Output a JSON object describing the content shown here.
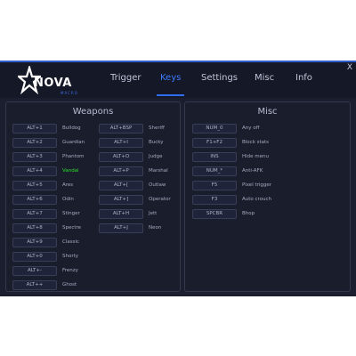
{
  "window": {
    "close_label": "X"
  },
  "logo": {
    "brand": "NOVA",
    "sub": "MACRO"
  },
  "tabs": [
    {
      "label": "Trigger"
    },
    {
      "label": "Keys"
    },
    {
      "label": "Settings"
    },
    {
      "label": "Misc"
    },
    {
      "label": "Info"
    }
  ],
  "active_tab": "Keys",
  "colors": {
    "accent": "#2f6cf0",
    "highlight": "#29e02b",
    "background": "#1b1e2e"
  },
  "weapons": {
    "title": "Weapons",
    "col1": [
      {
        "key": "ALT+1",
        "label": "Bulldog"
      },
      {
        "key": "ALT+2",
        "label": "Guardian"
      },
      {
        "key": "ALT+3",
        "label": "Phantom"
      },
      {
        "key": "ALT+4",
        "label": "Vandal"
      },
      {
        "key": "ALT+5",
        "label": "Ares"
      },
      {
        "key": "ALT+6",
        "label": "Odin"
      },
      {
        "key": "ALT+7",
        "label": "Stinger"
      },
      {
        "key": "ALT+8",
        "label": "Spectre"
      },
      {
        "key": "ALT+9",
        "label": "Classic"
      },
      {
        "key": "ALT+0",
        "label": "Shorty"
      },
      {
        "key": "ALT+-",
        "label": "Frenzy"
      },
      {
        "key": "ALT++",
        "label": "Ghost"
      }
    ],
    "col2": [
      {
        "key": "ALT+BSP",
        "label": "Sheriff"
      },
      {
        "key": "ALT+I",
        "label": "Bucky"
      },
      {
        "key": "ALT+O",
        "label": "Judge"
      },
      {
        "key": "ALT+P",
        "label": "Marshal"
      },
      {
        "key": "ALT+[",
        "label": "Outlaw"
      },
      {
        "key": "ALT+]",
        "label": "Operator"
      },
      {
        "key": "ALT+H",
        "label": "Jett"
      },
      {
        "key": "ALT+J",
        "label": "Neon"
      }
    ]
  },
  "misc": {
    "title": "Misc",
    "items": [
      {
        "key": "NUM_0",
        "label": "Any off"
      },
      {
        "key": "F1+F2",
        "label": "Block stats"
      },
      {
        "key": "INS",
        "label": "Hide menu"
      },
      {
        "key": "NUM_*",
        "label": "Anti-AFK"
      },
      {
        "key": "F5",
        "label": "Pixel trigger"
      },
      {
        "key": "F3",
        "label": "Auto crouch"
      },
      {
        "key": "SPCBR",
        "label": "Bhop"
      }
    ]
  }
}
